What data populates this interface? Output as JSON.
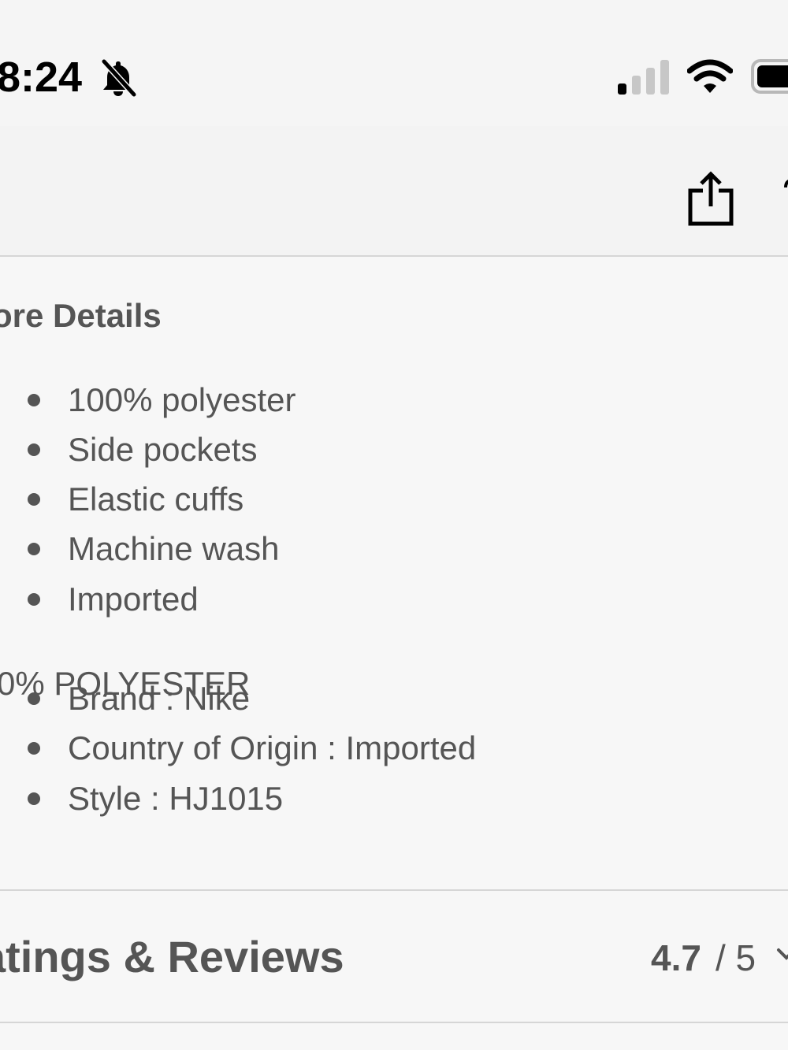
{
  "status_bar": {
    "time": "8:24",
    "icons": [
      "bell-slash-icon",
      "cellular-signal-icon",
      "wifi-icon",
      "battery-icon"
    ]
  },
  "toolbar": {
    "icons": [
      "share-icon"
    ]
  },
  "details": {
    "heading": "ore Details",
    "features": [
      "100% polyester",
      "Side pockets",
      "Elastic cuffs",
      "Machine wash",
      "Imported"
    ],
    "material": "0% POLYESTER",
    "attributes": [
      "Brand : Nike",
      "Country of Origin : Imported",
      "Style : HJ1015"
    ]
  },
  "ratings": {
    "title": "atings & Reviews",
    "score": "4.7",
    "scale": "/ 5",
    "icon": "chevron-down-icon"
  },
  "colors": {
    "background": "#f7f7f7",
    "text": "#555555",
    "divider": "#d6d6d6",
    "status_text": "#000000"
  }
}
